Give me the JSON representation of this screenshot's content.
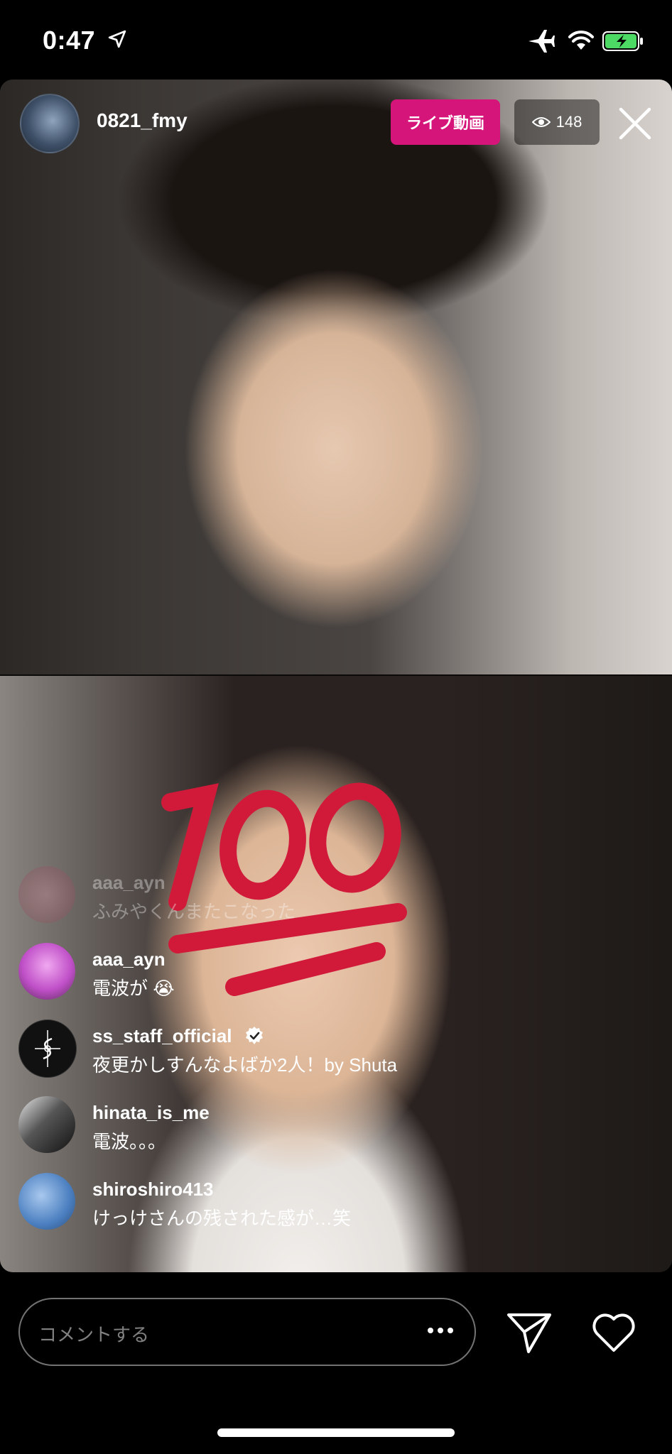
{
  "status_bar": {
    "time": "0:47"
  },
  "header": {
    "username": "0821_fmy",
    "live_label": "ライブ動画",
    "viewer_count": "148"
  },
  "comments": [
    {
      "user": "aaa_ayn",
      "text": "ふみやくんまたこなった",
      "avatar_color": "#b06070"
    },
    {
      "user": "aaa_ayn",
      "text": "電波が 😭",
      "avatar_color": "#c050c8"
    },
    {
      "user": "ss_staff_official",
      "text": "夜更かしすんなよばか2人！by Shuta",
      "avatar_color": "#111111",
      "verified": true
    },
    {
      "user": "hinata_is_me",
      "text": "電波。。。",
      "avatar_color": "#3a3a3a"
    },
    {
      "user": "shiroshiro413",
      "text": "けっけさんの残された感が…笑",
      "avatar_color": "#4b7fc0"
    }
  ],
  "composer": {
    "placeholder": "コメントする"
  },
  "overlay_emoji": "100",
  "colors": {
    "live_badge": "#d6157a",
    "emoji_red": "#d11a3a"
  }
}
